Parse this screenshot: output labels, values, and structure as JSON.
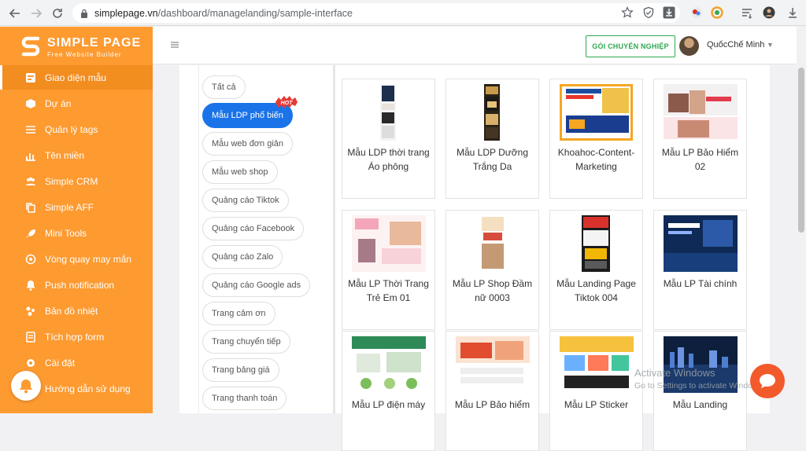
{
  "browser": {
    "url_host": "simplepage.vn",
    "url_path": "/dashboard/managelanding/sample-interface"
  },
  "brand": {
    "title": "SIMPLE PAGE",
    "subtitle": "Free Website Builder",
    "colors": {
      "sidebar": "#fd9a30",
      "primary": "#1a73e8",
      "pro": "#2ea84f"
    }
  },
  "sidebar": {
    "items": [
      {
        "label": "Giao diện mẫu",
        "icon": "template-icon",
        "active": true
      },
      {
        "label": "Dự án",
        "icon": "box-icon"
      },
      {
        "label": "Quản lý tags",
        "icon": "list-icon"
      },
      {
        "label": "Tên miền",
        "icon": "bar-chart-icon"
      },
      {
        "label": "Simple CRM",
        "icon": "users-icon"
      },
      {
        "label": "Simple AFF",
        "icon": "copy-icon"
      },
      {
        "label": "Mini Tools",
        "icon": "rocket-icon"
      },
      {
        "label": "Vòng quay may mắn",
        "icon": "target-icon"
      },
      {
        "label": "Push notification",
        "icon": "bell-icon"
      },
      {
        "label": "Bản đồ nhiệt",
        "icon": "heatmap-icon"
      },
      {
        "label": "Tích hợp form",
        "icon": "form-icon"
      },
      {
        "label": "Cài đặt",
        "icon": "gear-icon"
      },
      {
        "label": "Hướng dẫn sử dụng",
        "icon": "help-icon"
      }
    ]
  },
  "topbar": {
    "pro_button": "GÓI CHUYÊN NGHIỆP",
    "user_name": "QuốcChế Minh"
  },
  "categories": {
    "hot_label": "HOT",
    "items": [
      {
        "label": "Tất cả"
      },
      {
        "label": "Mẫu LDP phổ biến",
        "active": true
      },
      {
        "label": "Mẫu web đơn giản"
      },
      {
        "label": "Mẫu web shop"
      },
      {
        "label": "Quảng cáo Tiktok"
      },
      {
        "label": "Quảng cáo Facebook"
      },
      {
        "label": "Quảng cáo Zalo"
      },
      {
        "label": "Quảng cáo Google ads"
      },
      {
        "label": "Trang cảm ơn"
      },
      {
        "label": "Trang chuyển tiếp"
      },
      {
        "label": "Trang bảng giá"
      },
      {
        "label": "Trang thanh toán"
      }
    ]
  },
  "templates": [
    {
      "title": "Mẫu LDP thời trang Áo phông"
    },
    {
      "title": "Mẫu LDP Dưỡng Trắng Da"
    },
    {
      "title": "Khoahoc-Content-Marketing"
    },
    {
      "title": "Mẫu LP Bảo Hiểm 02"
    },
    {
      "title": "Mẫu LP Thời Trang Trẻ Em 01"
    },
    {
      "title": "Mẫu LP Shop Đầm nữ 0003"
    },
    {
      "title": "Mẫu Landing Page Tiktok 004"
    },
    {
      "title": "Mẫu LP Tài chính"
    },
    {
      "title": "Mẫu LP điện máy"
    },
    {
      "title": "Mẫu LP Bảo hiểm"
    },
    {
      "title": "Mẫu LP Sticker"
    },
    {
      "title": "Mẫu Landing"
    }
  ],
  "windows": {
    "line1": "Activate Windows",
    "line2": "Go to Settings to activate Windows."
  }
}
